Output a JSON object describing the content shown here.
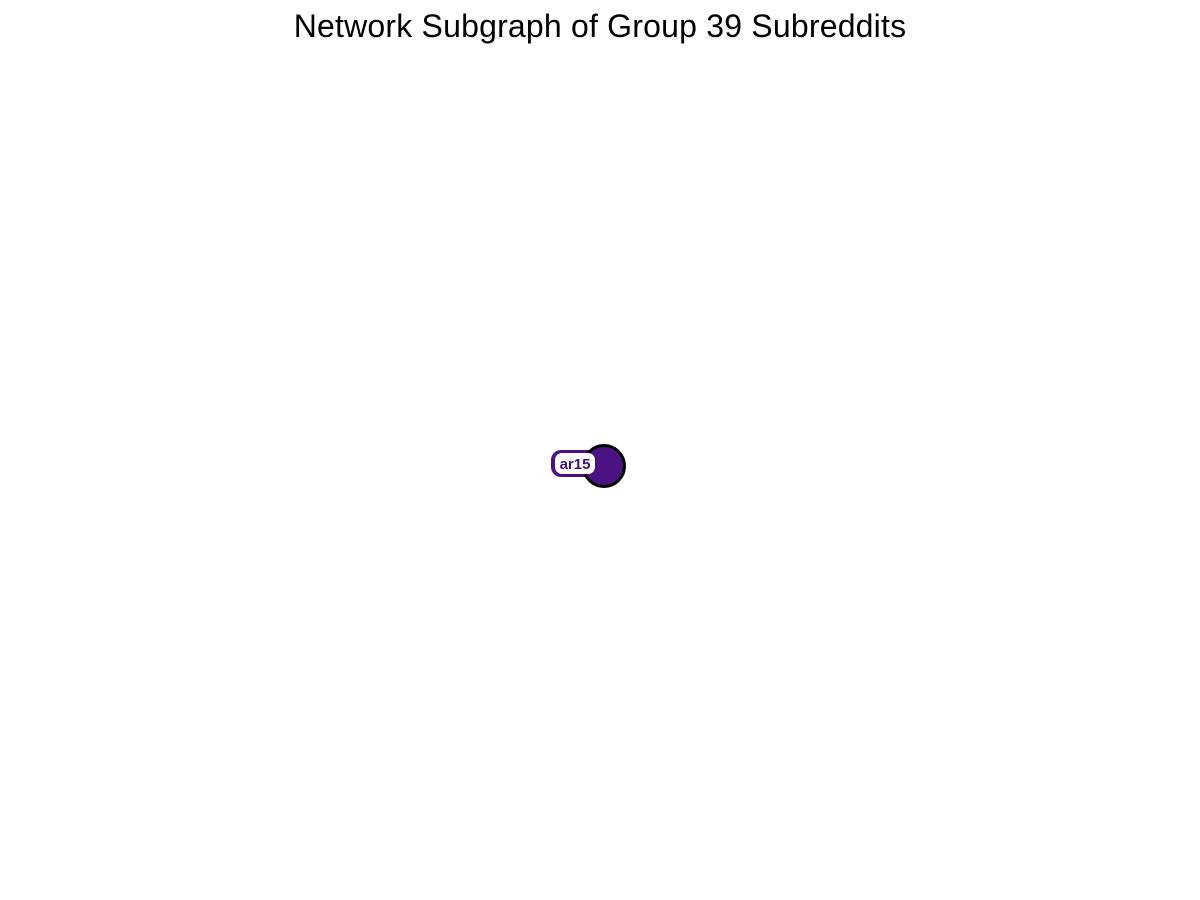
{
  "title": "Network Subgraph of Group 39 Subreddits",
  "colors": {
    "node_fill": "#4b1283",
    "node_stroke": "#000000",
    "label_fill": "#ffffff",
    "label_text": "#3f1278"
  },
  "nodes": [
    {
      "label": "ar15"
    }
  ]
}
